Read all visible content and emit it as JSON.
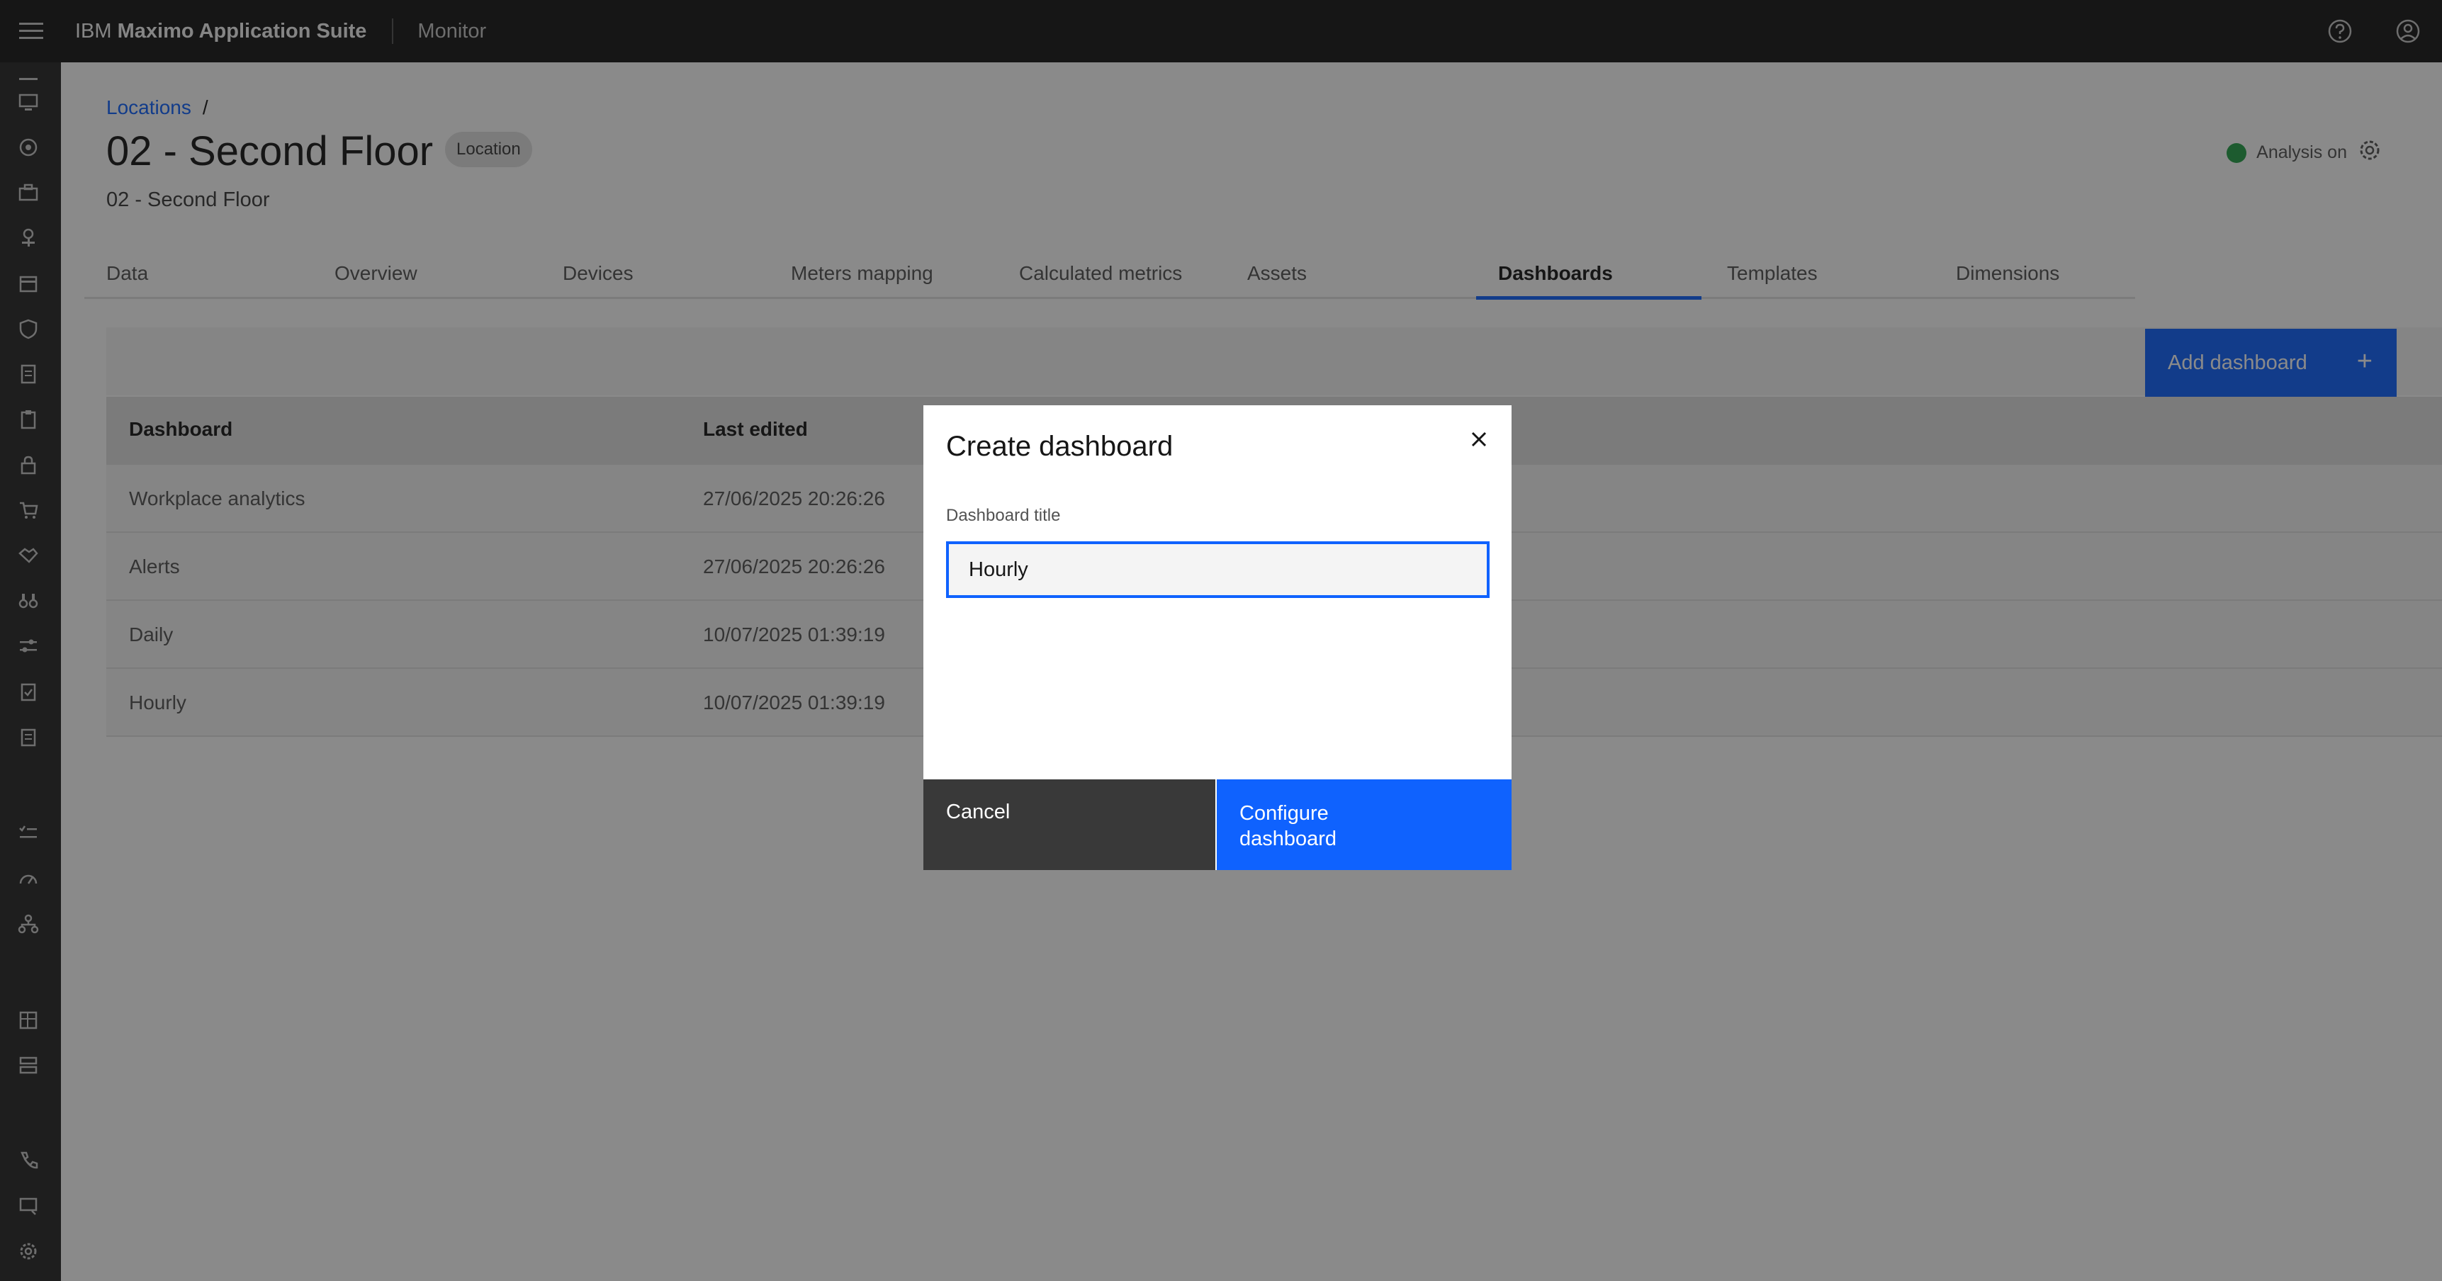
{
  "header": {
    "brand_prefix": "IBM",
    "brand_name": "Maximo Application Suite",
    "app_area": "Monitor",
    "icons": [
      "menu-icon",
      "help-icon",
      "user-icon"
    ]
  },
  "sidenav": {
    "icons": [
      "monitor-icon",
      "dashboard-icon",
      "briefcase-icon",
      "tree-icon",
      "calendar-icon",
      "shield-icon",
      "report-icon",
      "clipboard-icon",
      "lock-icon",
      "cart-icon",
      "handshake-icon",
      "binoculars-icon",
      "sliders-icon",
      "checklist-icon",
      "clipboard-check-icon",
      "task-list-icon",
      "gauge-icon",
      "hierarchy-icon",
      "data-table-icon",
      "layout-icon",
      "phone-icon",
      "screen-icon",
      "settings-icon"
    ]
  },
  "breadcrumb": {
    "link": "Locations",
    "separator": "/"
  },
  "page": {
    "title": "02 - Second Floor",
    "tag": "Location",
    "subtitle": "02 - Second Floor",
    "analysis_label": "Analysis on",
    "analysis_color": "#24a148"
  },
  "tabs": [
    "Data",
    "Overview",
    "Devices",
    "Meters mapping",
    "Calculated metrics",
    "Assets",
    "Dashboards",
    "Templates",
    "Dimensions"
  ],
  "active_tab": "Dashboards",
  "toolbar": {
    "add_label": "Add dashboard",
    "add_icon": "+"
  },
  "table": {
    "headers": [
      "Dashboard",
      "Last edited"
    ],
    "rows": [
      [
        "Workplace analytics",
        "27/06/2025 20:26:26"
      ],
      [
        "Alerts",
        "27/06/2025 20:26:26"
      ],
      [
        "Daily",
        "10/07/2025 01:39:19"
      ],
      [
        "Hourly",
        "10/07/2025 01:39:19"
      ]
    ]
  },
  "modal": {
    "title": "Create dashboard",
    "close_icon": "close-icon",
    "field_label": "Dashboard title",
    "field_value": "Hourly",
    "cancel_label": "Cancel",
    "confirm_label": "Configure\ndashboard"
  },
  "colors": {
    "primary": "#0f62fe",
    "header_bg": "#161616",
    "cancel_bg": "#393939"
  }
}
